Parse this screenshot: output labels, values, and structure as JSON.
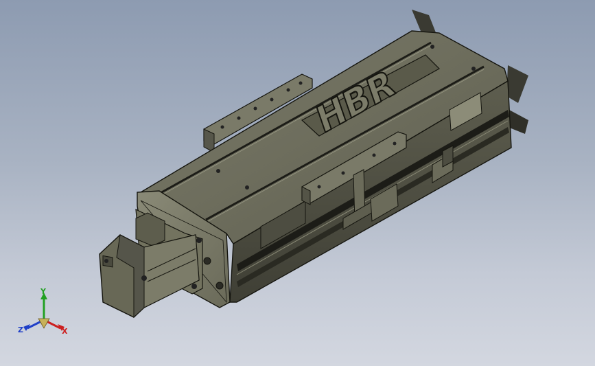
{
  "viewport": {
    "background_top": "#8d9bb1",
    "background_bottom": "#d3d7e0"
  },
  "model": {
    "logo_text": "HBR",
    "body_color": "#6e6e5d",
    "edge_color": "#15150f"
  },
  "triad": {
    "x_label": "X",
    "y_label": "Y",
    "z_label": "Z",
    "x_color": "#cc2020",
    "y_color": "#22a022",
    "z_color": "#2040c8"
  }
}
